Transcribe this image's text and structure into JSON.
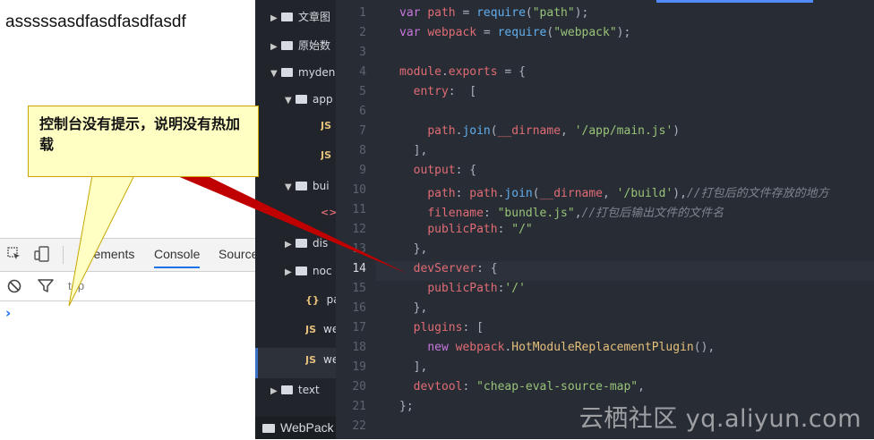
{
  "browser": {
    "page_text": "asssssasdfasdfasdfasdf",
    "devtools": {
      "tabs": [
        "Elements",
        "Console",
        "Source"
      ],
      "active_tab": "Console",
      "filter_context": "top",
      "prompt": "›"
    }
  },
  "callout": {
    "text": "控制台没有提示，说明没有热加载"
  },
  "sidebar": {
    "items": [
      {
        "label": "文章图",
        "type": "folder",
        "expanded": false
      },
      {
        "label": "原始数",
        "type": "folder",
        "expanded": false
      },
      {
        "label": "myden",
        "type": "folder",
        "expanded": true
      },
      {
        "label": "app",
        "type": "folder",
        "expanded": true
      },
      {
        "label": "JS",
        "type": "js"
      },
      {
        "label": "JS",
        "type": "js"
      },
      {
        "label": "bui",
        "type": "folder",
        "expanded": true
      },
      {
        "label": "<>",
        "type": "html"
      },
      {
        "label": "dis",
        "type": "folder",
        "expanded": false
      },
      {
        "label": "noc",
        "type": "folder",
        "expanded": false
      },
      {
        "label": "pa",
        "type": "json"
      },
      {
        "label": "we",
        "type": "js"
      },
      {
        "label": "we",
        "type": "js",
        "selected": true
      },
      {
        "label": "text",
        "type": "folder",
        "expanded": false
      }
    ],
    "bottom_tab": "WebPack"
  },
  "editor": {
    "active_line": 14,
    "lines": [
      [
        [
          "k",
          "var"
        ],
        [
          "p",
          " "
        ],
        [
          "v",
          "path"
        ],
        [
          "p",
          " = "
        ],
        [
          "f",
          "require"
        ],
        [
          "p",
          "("
        ],
        [
          "s",
          "\"path\""
        ],
        [
          "p",
          ");"
        ]
      ],
      [
        [
          "k",
          "var"
        ],
        [
          "p",
          " "
        ],
        [
          "v",
          "webpack"
        ],
        [
          "p",
          " = "
        ],
        [
          "f",
          "require"
        ],
        [
          "p",
          "("
        ],
        [
          "s",
          "\"webpack\""
        ],
        [
          "p",
          ");"
        ]
      ],
      [],
      [
        [
          "v",
          "module"
        ],
        [
          "p",
          "."
        ],
        [
          "v",
          "exports"
        ],
        [
          "p",
          " = {"
        ]
      ],
      [
        [
          "p",
          "  "
        ],
        [
          "v",
          "entry"
        ],
        [
          "p",
          ":  ["
        ]
      ],
      [],
      [
        [
          "p",
          "    "
        ],
        [
          "v",
          "path"
        ],
        [
          "p",
          "."
        ],
        [
          "f",
          "join"
        ],
        [
          "p",
          "("
        ],
        [
          "v",
          "__dirname"
        ],
        [
          "p",
          ", "
        ],
        [
          "s",
          "'/app/main.js'"
        ],
        [
          "p",
          ")"
        ]
      ],
      [
        [
          "p",
          "  ],"
        ]
      ],
      [
        [
          "p",
          "  "
        ],
        [
          "v",
          "output"
        ],
        [
          "p",
          ": {"
        ]
      ],
      [
        [
          "p",
          "    "
        ],
        [
          "v",
          "path"
        ],
        [
          "p",
          ": "
        ],
        [
          "v",
          "path"
        ],
        [
          "p",
          "."
        ],
        [
          "f",
          "join"
        ],
        [
          "p",
          "("
        ],
        [
          "v",
          "__dirname"
        ],
        [
          "p",
          ", "
        ],
        [
          "s",
          "'/build'"
        ],
        [
          "p",
          "),"
        ],
        [
          "c",
          "//打包后的文件存放的地方"
        ]
      ],
      [
        [
          "p",
          "    "
        ],
        [
          "v",
          "filename"
        ],
        [
          "p",
          ": "
        ],
        [
          "s",
          "\"bundle.js\""
        ],
        [
          "p",
          ","
        ],
        [
          "c",
          "//打包后输出文件的文件名"
        ]
      ],
      [
        [
          "p",
          "    "
        ],
        [
          "v",
          "publicPath"
        ],
        [
          "p",
          ": "
        ],
        [
          "s",
          "\"/\""
        ]
      ],
      [
        [
          "p",
          "  },"
        ]
      ],
      [
        [
          "p",
          "  "
        ],
        [
          "v",
          "devServer"
        ],
        [
          "p",
          ": {"
        ]
      ],
      [
        [
          "p",
          "    "
        ],
        [
          "v",
          "publicPath"
        ],
        [
          "p",
          ":"
        ],
        [
          "s",
          "'/'"
        ]
      ],
      [
        [
          "p",
          "  },"
        ]
      ],
      [
        [
          "p",
          "  "
        ],
        [
          "v",
          "plugins"
        ],
        [
          "p",
          ": ["
        ]
      ],
      [
        [
          "p",
          "    "
        ],
        [
          "k",
          "new"
        ],
        [
          "p",
          " "
        ],
        [
          "v",
          "webpack"
        ],
        [
          "p",
          "."
        ],
        [
          "cls",
          "HotModuleReplacementPlugin"
        ],
        [
          "p",
          "(),"
        ]
      ],
      [
        [
          "p",
          "  ],"
        ]
      ],
      [
        [
          "p",
          "  "
        ],
        [
          "v",
          "devtool"
        ],
        [
          "p",
          ": "
        ],
        [
          "s",
          "\"cheap-eval-source-map\""
        ],
        [
          "p",
          ","
        ]
      ],
      [
        [
          "p",
          "};"
        ]
      ],
      []
    ]
  },
  "watermark": "云栖社区 yq.aliyun.com"
}
